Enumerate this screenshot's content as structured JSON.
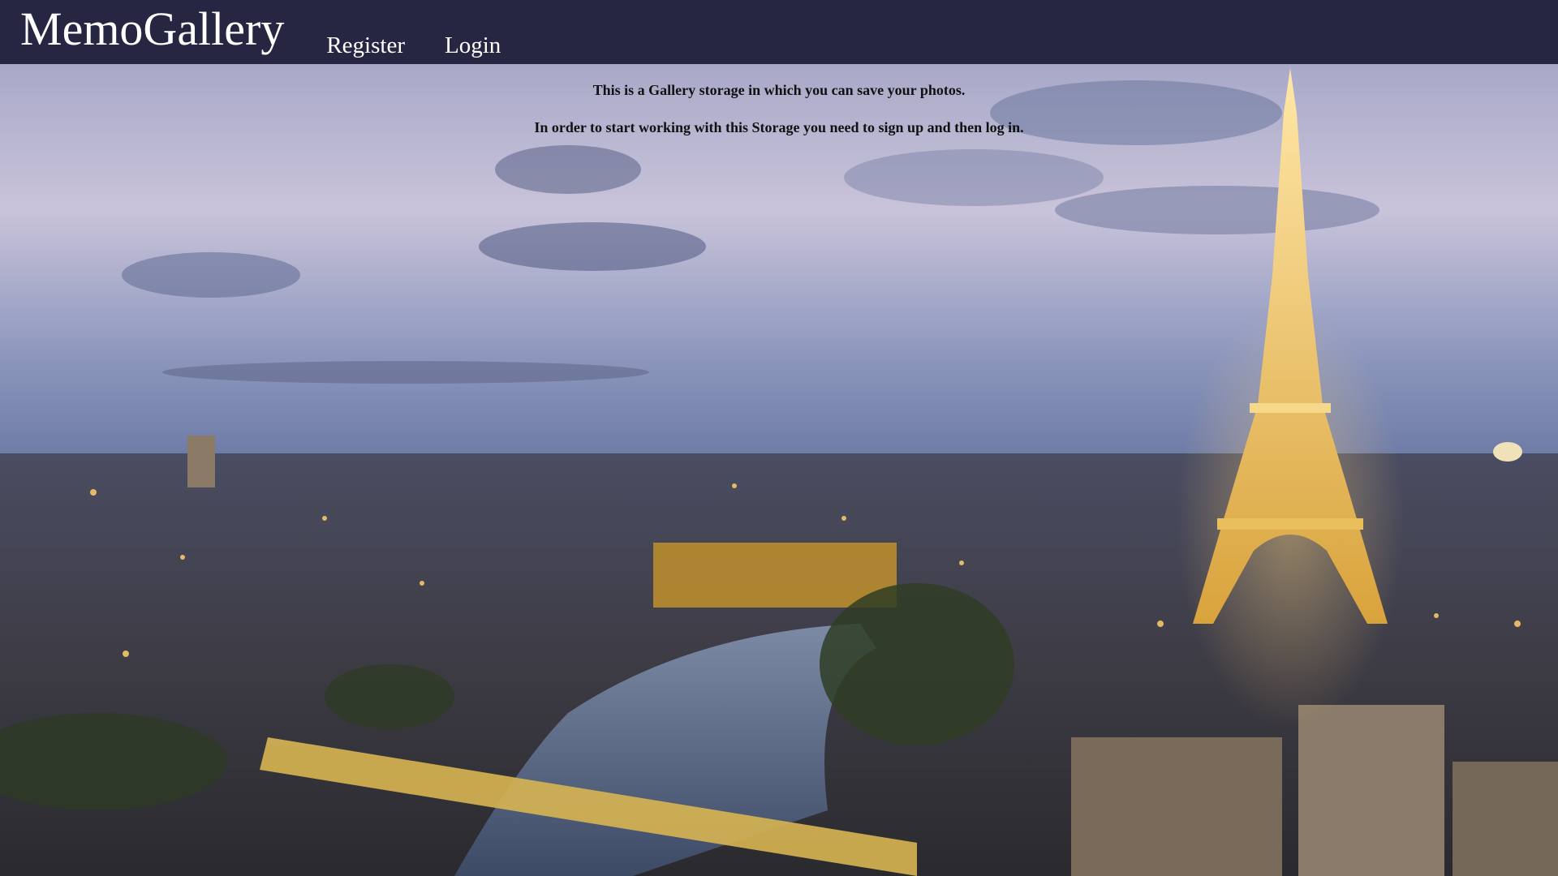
{
  "header": {
    "brand": "MemoGallery",
    "nav": [
      {
        "label": "Register"
      },
      {
        "label": "Login"
      }
    ]
  },
  "hero": {
    "background": "Paris skyline at dusk with the Eiffel Tower",
    "intro_line_1": "This is a Gallery storage in which you can save your photos.",
    "intro_line_2": "In order to start working with this Storage you need to sign up and then log in."
  },
  "colors": {
    "navbar": "#262642",
    "nav_text": "#ffffff",
    "intro_text": "#111111"
  }
}
